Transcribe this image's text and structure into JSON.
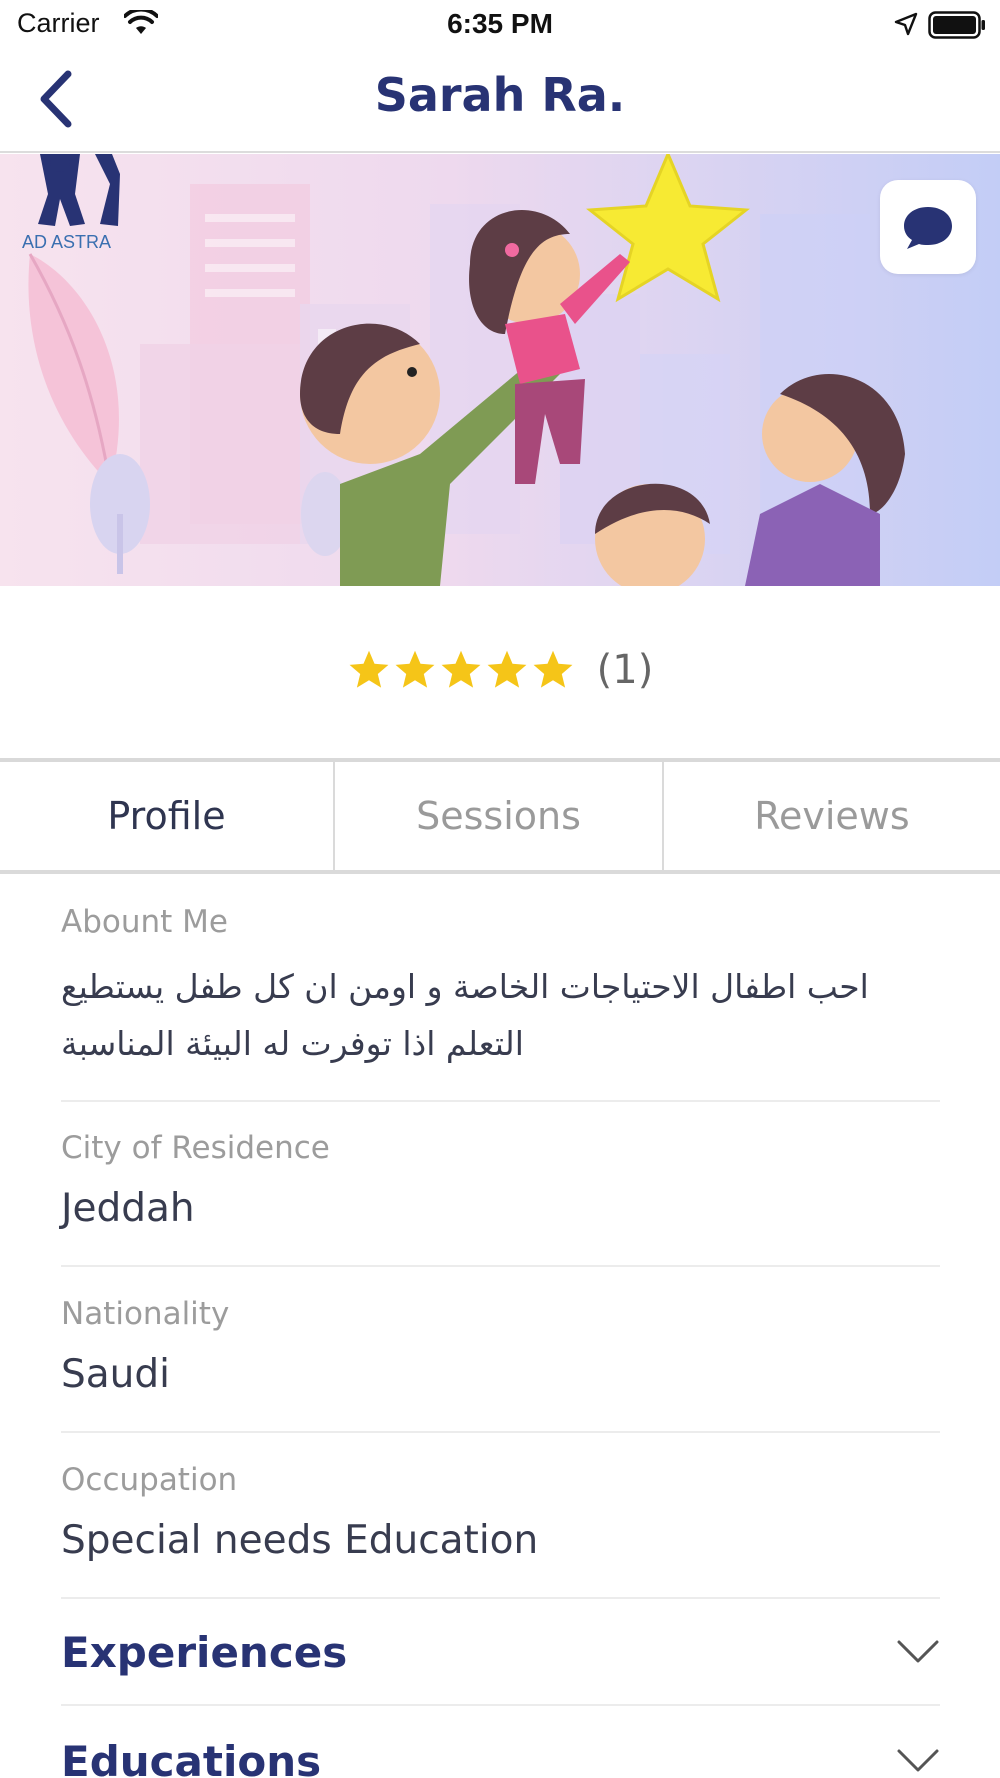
{
  "status_bar": {
    "carrier": "Carrier",
    "time": "6:35 PM"
  },
  "nav": {
    "title": "Sarah Ra.",
    "back_icon": "chevron-left-icon"
  },
  "banner": {
    "logo_text": "AD ASTRA",
    "chat_icon": "chat-bubble-icon"
  },
  "rating": {
    "stars": 5,
    "count_label": "(1)",
    "star_color": "#F5C518"
  },
  "tabs": [
    {
      "label": "Profile",
      "active": true
    },
    {
      "label": "Sessions",
      "active": false
    },
    {
      "label": "Reviews",
      "active": false
    }
  ],
  "profile": {
    "about_label": "Abount Me",
    "about_value": "احب اطفال الاحتياجات الخاصة و اومن ان كل طفل يستطيع التعلم اذا توفرت له البيئة المناسبة",
    "city_label": "City of Residence",
    "city_value": "Jeddah",
    "nationality_label": "Nationality",
    "nationality_value": "Saudi",
    "occupation_label": "Occupation",
    "occupation_value": "Special needs Education"
  },
  "sections": {
    "experiences": "Experiences",
    "educations": "Educations"
  },
  "colors": {
    "accent": "#283374",
    "star": "#F5C518",
    "muted": "#9A9A9A"
  }
}
